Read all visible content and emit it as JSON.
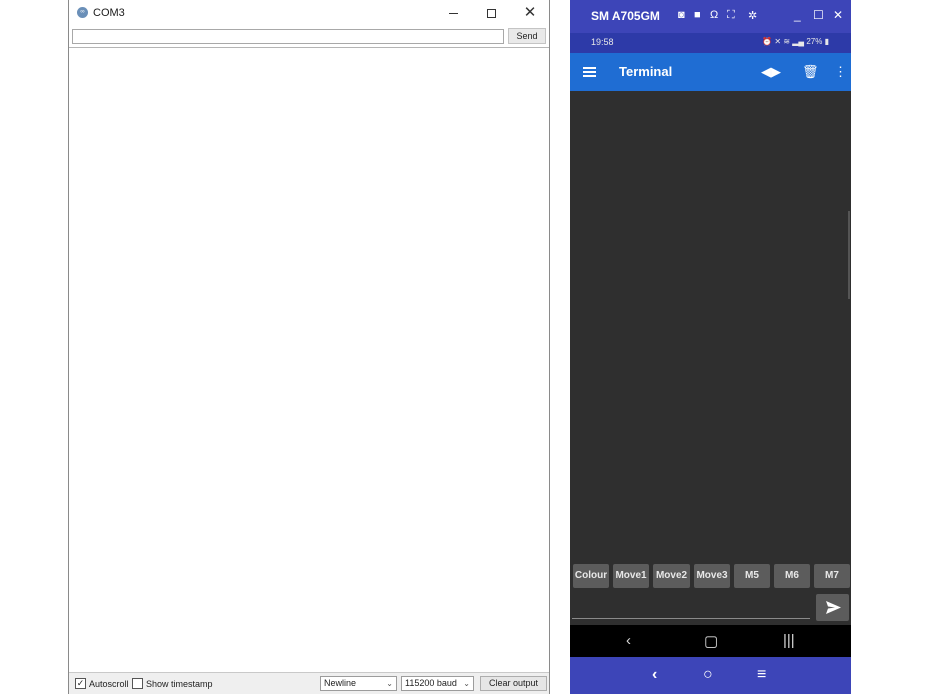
{
  "serial_monitor": {
    "title": "COM3",
    "input_value": "",
    "send_label": "Send",
    "output_text": "",
    "footer": {
      "autoscroll_label": "Autoscroll",
      "autoscroll_checked": true,
      "timestamp_label": "Show timestamp",
      "timestamp_checked": false,
      "line_ending": "Newline",
      "baud_rate": "115200 baud",
      "clear_label": "Clear output"
    }
  },
  "phone_mirror": {
    "device_name": "SM A705GM",
    "accent": "#3d45b8",
    "status_bar": {
      "time": "19:58",
      "battery": "27%"
    },
    "app_bar": {
      "title": "Terminal",
      "color": "#1f6dd3"
    },
    "macro_buttons": [
      "Colour",
      "Move1",
      "Move2",
      "Move3",
      "M5",
      "M6",
      "M7"
    ],
    "icons": {
      "connect": "connect-icon",
      "delete": "trash-icon",
      "more": "more-vert-icon",
      "menu": "menu-icon",
      "send": "send-icon"
    }
  }
}
